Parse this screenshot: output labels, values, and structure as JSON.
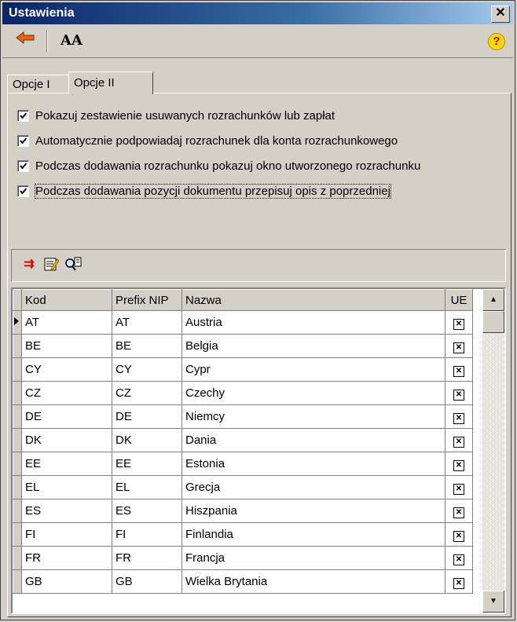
{
  "window": {
    "title": "Ustawienia"
  },
  "toolbar": {
    "back_icon": "back-arrow-icon",
    "font_label": "AA",
    "help_label": "?"
  },
  "tabs": [
    {
      "label": "Opcje I"
    },
    {
      "label": "Opcje II"
    }
  ],
  "options": [
    {
      "label": "Pokazuj zestawienie usuwanych rozrachunków lub zapłat",
      "checked": true
    },
    {
      "label": "Automatycznie podpowiadaj rozrachunek dla konta rozrachunkowego",
      "checked": true
    },
    {
      "label": "Podczas dodawania rozrachunku pokazuj okno utworzonego rozrachunku",
      "checked": true
    },
    {
      "label": "Podczas dodawania pozycji dokumentu przepisuj opis z poprzedniej",
      "checked": true
    }
  ],
  "grid": {
    "columns": [
      "Kod",
      "Prefix NIP",
      "Nazwa",
      "UE"
    ],
    "rows": [
      {
        "kod": "AT",
        "prefix": "AT",
        "nazwa": "Austria",
        "ue": true
      },
      {
        "kod": "BE",
        "prefix": "BE",
        "nazwa": "Belgia",
        "ue": true
      },
      {
        "kod": "CY",
        "prefix": "CY",
        "nazwa": "Cypr",
        "ue": true
      },
      {
        "kod": "CZ",
        "prefix": "CZ",
        "nazwa": "Czechy",
        "ue": true
      },
      {
        "kod": "DE",
        "prefix": "DE",
        "nazwa": "Niemcy",
        "ue": true
      },
      {
        "kod": "DK",
        "prefix": "DK",
        "nazwa": "Dania",
        "ue": true
      },
      {
        "kod": "EE",
        "prefix": "EE",
        "nazwa": "Estonia",
        "ue": true
      },
      {
        "kod": "EL",
        "prefix": "EL",
        "nazwa": "Grecja",
        "ue": true
      },
      {
        "kod": "ES",
        "prefix": "ES",
        "nazwa": "Hiszpania",
        "ue": true
      },
      {
        "kod": "FI",
        "prefix": "FI",
        "nazwa": "Finlandia",
        "ue": true
      },
      {
        "kod": "FR",
        "prefix": "FR",
        "nazwa": "Francja",
        "ue": true
      },
      {
        "kod": "GB",
        "prefix": "GB",
        "nazwa": "Wielka Brytania",
        "ue": true
      }
    ]
  }
}
